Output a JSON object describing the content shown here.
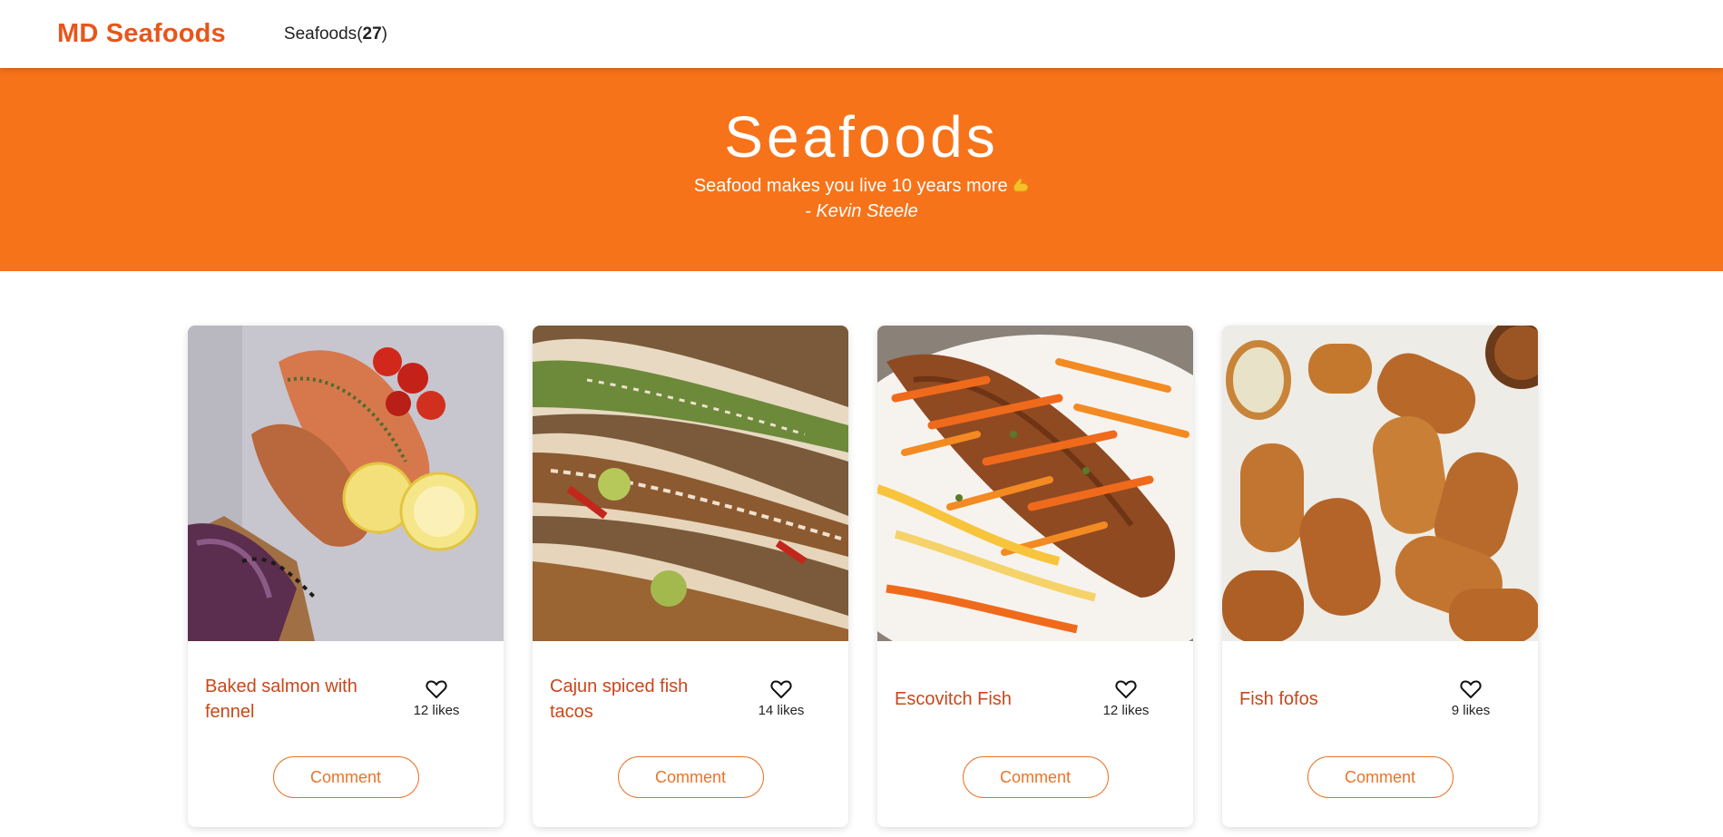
{
  "app": {
    "brand": "MD Seafoods",
    "nav_label": "Seafoods",
    "nav_count": "27",
    "accent": "#f7731a",
    "brand_color": "#e8551b",
    "title_color": "#c8471a"
  },
  "hero": {
    "title": "Seafoods",
    "quote": "Seafood makes you live 10 years more",
    "quote_emoji": "flexed-biceps-icon",
    "author": "- Kevin Steele"
  },
  "cards": [
    {
      "title": "Baked salmon with fennel",
      "likes": "12 likes",
      "comment_label": "Comment",
      "image": "baked-salmon-photo"
    },
    {
      "title": "Cajun spiced fish tacos",
      "likes": "14 likes",
      "comment_label": "Comment",
      "image": "fish-tacos-photo"
    },
    {
      "title": "Escovitch Fish",
      "likes": "12 likes",
      "comment_label": "Comment",
      "image": "escovitch-fish-photo"
    },
    {
      "title": "Fish fofos",
      "likes": "9 likes",
      "comment_label": "Comment",
      "image": "fish-fofos-photo"
    }
  ]
}
